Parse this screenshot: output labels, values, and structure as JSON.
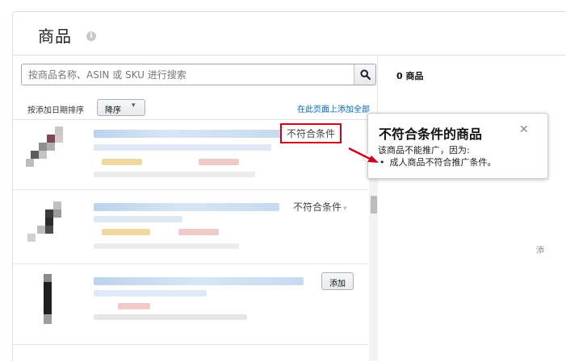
{
  "header": {
    "title": "商品",
    "info_icon": "info-icon"
  },
  "search": {
    "placeholder": "按商品名称、ASIN 或 SKU 进行搜索",
    "value": "",
    "button_icon": "search-icon"
  },
  "sort": {
    "label": "按添加日期排序",
    "selected": "降序",
    "add_all_link": "在此页面上添加全部"
  },
  "products": [
    {
      "status": "不符合条件",
      "highlighted": true
    },
    {
      "status": "不符合条件",
      "highlighted": false
    },
    {
      "action": "添加"
    }
  ],
  "right_panel": {
    "count_label": "0 商品",
    "edge_text": "添"
  },
  "popover": {
    "title": "不符合条件的商品",
    "body": "该商品不能推广，因为:",
    "reason_bullet": "•",
    "reason": "成人商品不符合推广条件。",
    "close_icon": "close-icon"
  },
  "colors": {
    "link": "#0066c0",
    "highlight": "#d0021b",
    "arrow": "#d0021b"
  }
}
